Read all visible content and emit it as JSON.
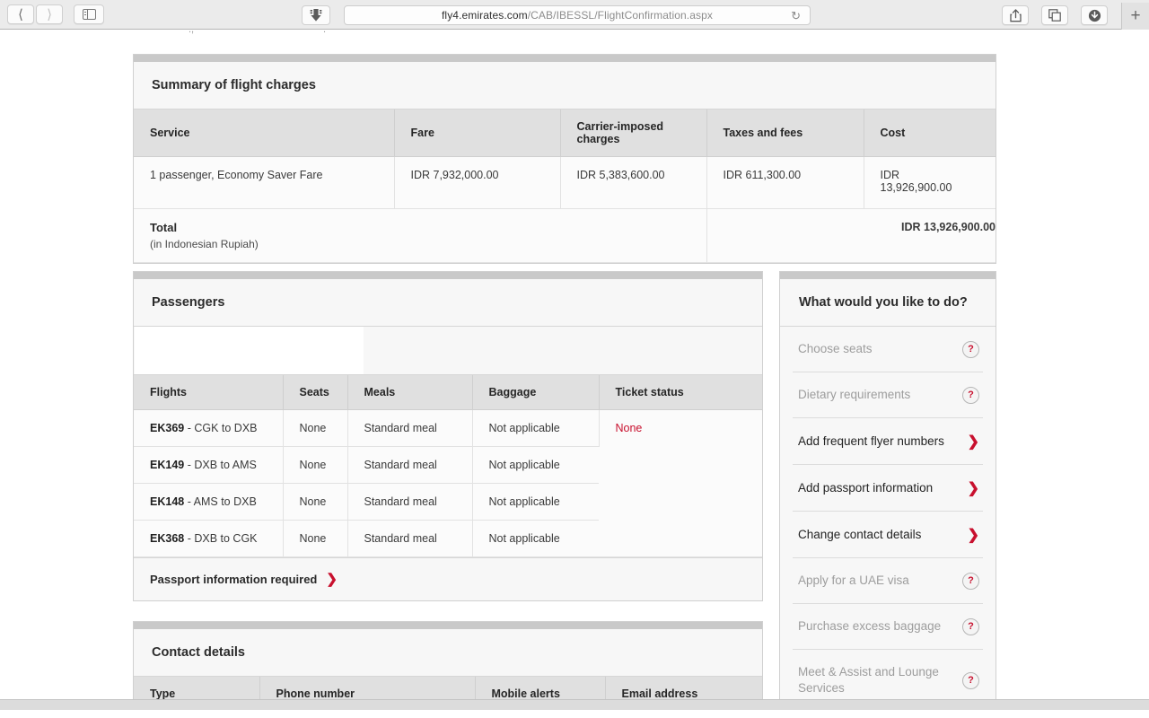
{
  "browser": {
    "back_icon": "chevron-left-icon",
    "forward_icon": "chevron-right-icon",
    "sidebar_icon": "sidebar-toggle-icon",
    "download_arrow_icon": "download-arrow-icon",
    "url_domain": "fly4.emirates.com",
    "url_path": "/CAB/IBESSL/FlightConfirmation.aspx",
    "reload_icon": "reload-icon",
    "share_icon": "share-icon",
    "tabs_icon": "show-tabs-icon",
    "downloads_icon": "downloads-icon",
    "newtab_label": "+"
  },
  "charges": {
    "title": "Summary of flight charges",
    "columns": [
      "Service",
      "Fare",
      "Carrier-imposed charges",
      "Taxes and fees",
      "Cost"
    ],
    "rows": [
      {
        "service": "1 passenger, Economy Saver Fare",
        "fare": "IDR 7,932,000.00",
        "carrier": "IDR 5,383,600.00",
        "taxes": "IDR 611,300.00",
        "cost_currency": "IDR",
        "cost_amount": "13,926,900.00"
      }
    ],
    "total_label": "Total",
    "total_sub": "(in Indonesian Rupiah)",
    "total_amount": "IDR 13,926,900.00"
  },
  "passengers": {
    "title": "Passengers",
    "columns": [
      "Flights",
      "Seats",
      "Meals",
      "Baggage",
      "Ticket status"
    ],
    "rows": [
      {
        "flight_code": "EK369",
        "route": " - CGK to DXB",
        "seats": "None",
        "meals": "Standard meal",
        "baggage": "Not applicable"
      },
      {
        "flight_code": "EK149",
        "route": " - DXB to AMS",
        "seats": "None",
        "meals": "Standard meal",
        "baggage": "Not applicable"
      },
      {
        "flight_code": "EK148",
        "route": " - AMS to DXB",
        "seats": "None",
        "meals": "Standard meal",
        "baggage": "Not applicable"
      },
      {
        "flight_code": "EK368",
        "route": " - DXB to CGK",
        "seats": "None",
        "meals": "Standard meal",
        "baggage": "Not applicable"
      }
    ],
    "ticket_status": "None",
    "footer_link": "Passport information required",
    "footer_chevron": "❯"
  },
  "contact": {
    "title": "Contact details",
    "columns": [
      "Type",
      "Phone number",
      "Mobile alerts",
      "Email address"
    ]
  },
  "actions": {
    "title": "What would you like to do?",
    "items": [
      {
        "label": "Choose seats",
        "enabled": false,
        "icon": "?"
      },
      {
        "label": "Dietary requirements",
        "enabled": false,
        "icon": "?"
      },
      {
        "label": "Add frequent flyer numbers",
        "enabled": true,
        "icon": "❯"
      },
      {
        "label": "Add passport information",
        "enabled": true,
        "icon": "❯"
      },
      {
        "label": "Change contact details",
        "enabled": true,
        "icon": "❯"
      },
      {
        "label": "Apply for a UAE visa",
        "enabled": false,
        "icon": "?"
      },
      {
        "label": "Purchase excess baggage",
        "enabled": false,
        "icon": "?"
      },
      {
        "label": "Meet & Assist and Lounge Services",
        "enabled": false,
        "icon": "?"
      }
    ]
  },
  "colors": {
    "brand_red": "#c8102e",
    "panel_accent": "#c9c9c9",
    "header_bg": "#e0e0e0"
  }
}
